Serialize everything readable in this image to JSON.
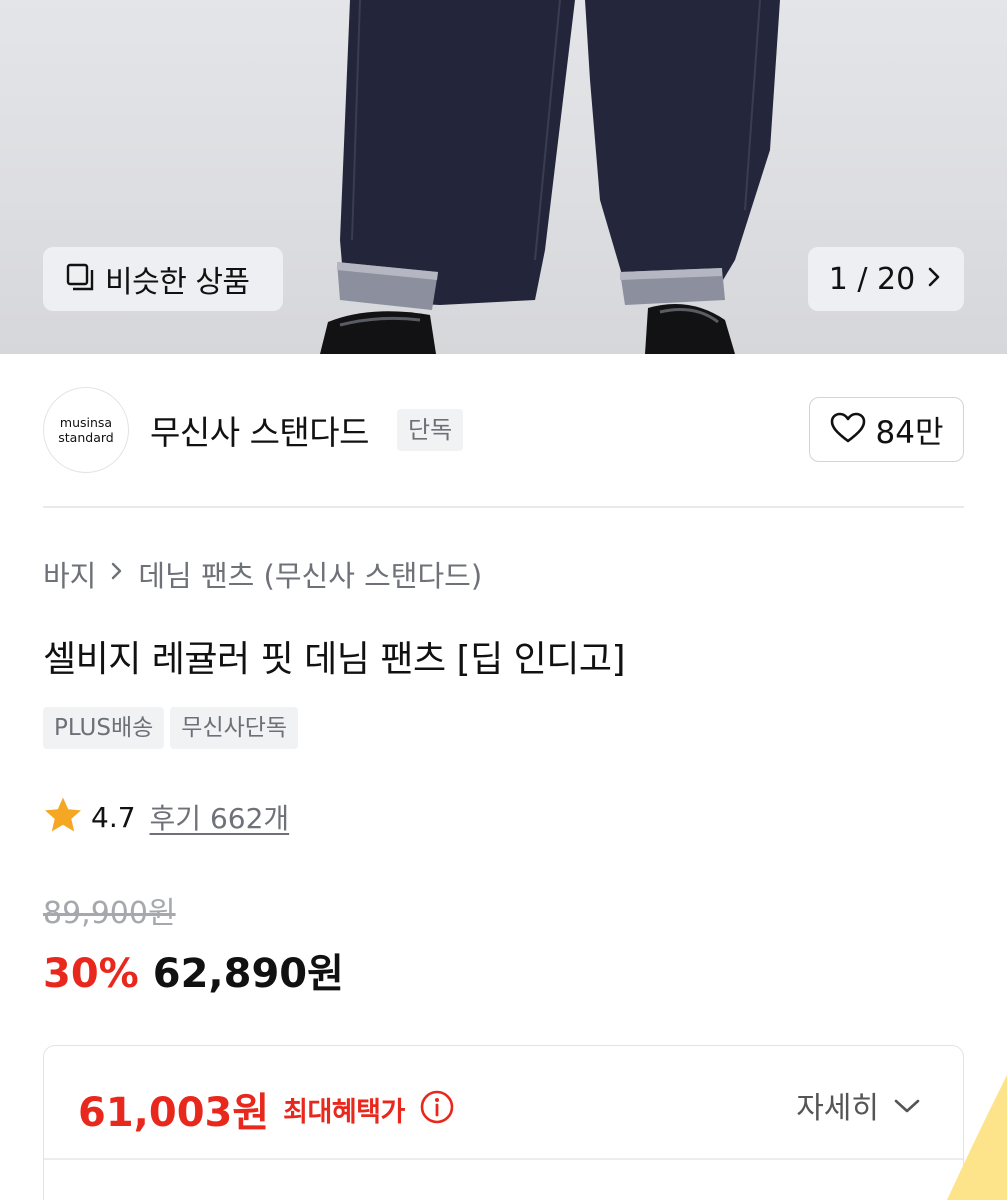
{
  "hero": {
    "similar_label": "비슷한 상품",
    "counter": "1 / 20"
  },
  "brand": {
    "logo_line1": "musinsa",
    "logo_line2": "standard",
    "name": "무신사 스탠다드",
    "badge": "단독",
    "likes": "84만"
  },
  "product": {
    "breadcrumb": [
      "바지",
      "데님 팬츠 (무신사 스탠다드)"
    ],
    "title": "셀비지 레귤러 핏 데님 팬츠 [딥 인디고]",
    "tags": [
      "PLUS배송",
      "무신사단독"
    ],
    "rating": "4.7",
    "reviews": "후기 662개",
    "original_price": "89,900원",
    "discount": "30%",
    "sale_price": "62,890원"
  },
  "benefit": {
    "price": "61,003원",
    "label": "최대혜택가",
    "detail": "자세히"
  },
  "colors": {
    "accent_red": "#e8281d",
    "star": "#f5a623"
  },
  "icons": [
    "similar-items-icon",
    "chevron-right-icon",
    "heart-icon",
    "star-icon",
    "info-icon",
    "chevron-down-icon"
  ]
}
